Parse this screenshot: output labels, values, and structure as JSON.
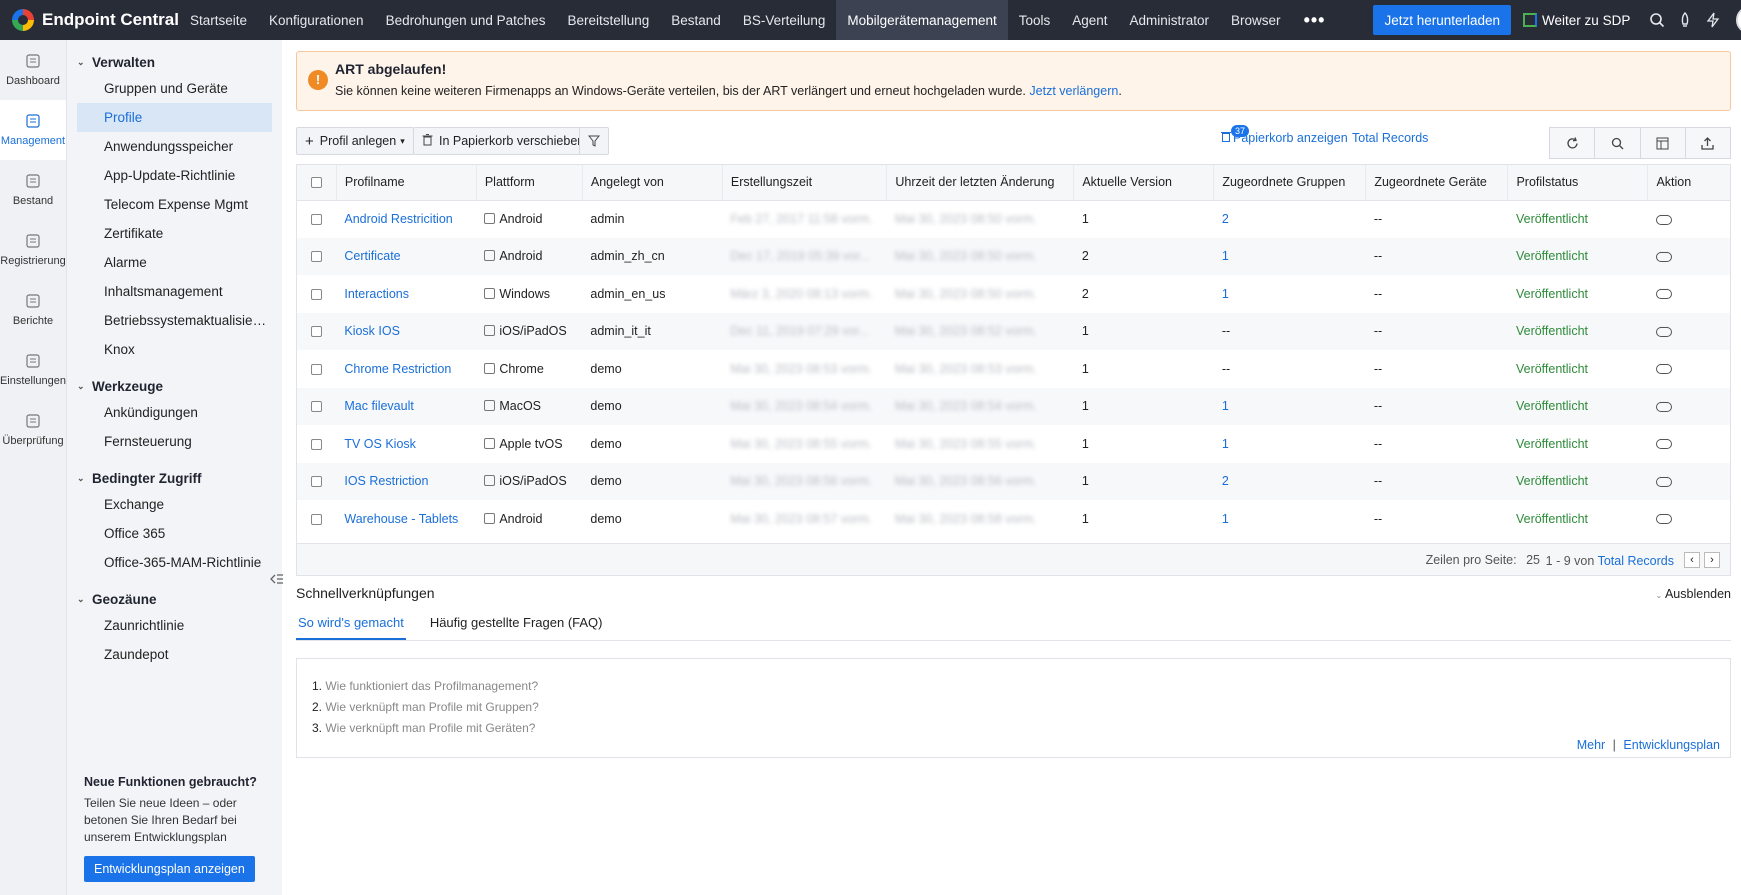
{
  "brand": {
    "name": "Endpoint Central"
  },
  "nav": {
    "items": [
      "Startseite",
      "Konfigurationen",
      "Bedrohungen und Patches",
      "Bereitstellung",
      "Bestand",
      "BS-Verteilung",
      "Mobilgerätemanagement",
      "Tools",
      "Agent",
      "Administrator",
      "Browser"
    ],
    "active_index": 6,
    "more": "•••",
    "download_label": "Jetzt herunterladen",
    "sdp_label": "Weiter zu SDP"
  },
  "rail": [
    {
      "label": "Dashboard",
      "icon": "dashboard-icon"
    },
    {
      "label": "Management",
      "icon": "management-icon",
      "active": true
    },
    {
      "label": "Bestand",
      "icon": "inventory-icon"
    },
    {
      "label": "Registrierung",
      "icon": "enrollment-icon"
    },
    {
      "label": "Berichte",
      "icon": "reports-icon"
    },
    {
      "label": "Einstellungen",
      "icon": "settings-icon"
    },
    {
      "label": "Überprüfung",
      "icon": "audit-icon"
    }
  ],
  "sidebar": {
    "sections": [
      {
        "title": "Verwalten",
        "items": [
          "Gruppen und Geräte",
          "Profile",
          "Anwendungsspeicher",
          "App-Update-Richtlinie",
          "Telecom Expense Mgmt",
          "Zertifikate",
          "Alarme",
          "Inhaltsmanagement",
          "Betriebssystemaktualisierung...",
          "Knox"
        ]
      },
      {
        "title": "Werkzeuge",
        "items": [
          "Ankündigungen",
          "Fernsteuerung"
        ]
      },
      {
        "title": "Bedingter Zugriff",
        "items": [
          "Exchange",
          "Office 365",
          "Office-365-MAM-Richtlinie"
        ]
      },
      {
        "title": "Geozäune",
        "items": [
          "Zaunrichtlinie",
          "Zaundepot"
        ]
      }
    ],
    "promo": {
      "title": "Neue Funktionen gebraucht?",
      "text": "Teilen Sie neue Ideen – oder betonen Sie Ihren Bedarf bei unserem Entwicklungsplan",
      "button": "Entwicklungsplan anzeigen"
    }
  },
  "alert": {
    "title": "ART abgelaufen!",
    "text": "Sie können keine weiteren Firmenapps an Windows-Geräte verteilen, bis der ART verlängert und erneut hochgeladen wurde.",
    "link": "Jetzt verlängern",
    "link_suffix": "."
  },
  "toolbar": {
    "create_label": "Profil anlegen",
    "trash_label": "In Papierkorb verschieben",
    "trash_count": "37",
    "show_trash": "Papierkorb anzeigen",
    "total_records": "Total Records"
  },
  "table": {
    "columns": [
      "Profilname",
      "Plattform",
      "Angelegt von",
      "Erstellungszeit",
      "Uhrzeit der letzten Änderung",
      "Aktuelle Version",
      "Zugeordnete Gruppen",
      "Zugeordnete Geräte",
      "Profilstatus",
      "Aktion"
    ],
    "rows": [
      {
        "name": "Android Restricition",
        "platform": "Android",
        "created_by": "admin",
        "created": "Feb 27, 2017 11:58 vorm.",
        "modified": "Mai 30, 2023 08:50 vorm.",
        "version": "1",
        "groups": "2",
        "devices": "--",
        "status": "Veröffentlicht"
      },
      {
        "name": "Certificate",
        "platform": "Android",
        "created_by": "admin_zh_cn",
        "created": "Dec 17, 2019 05:39 vor...",
        "modified": "Mai 30, 2023 08:50 vorm.",
        "version": "2",
        "groups": "1",
        "devices": "--",
        "status": "Veröffentlicht"
      },
      {
        "name": "Interactions",
        "platform": "Windows",
        "created_by": "admin_en_us",
        "created": "März 3, 2020 08:13 vorm.",
        "modified": "Mai 30, 2023 08:50 vorm.",
        "version": "2",
        "groups": "1",
        "devices": "--",
        "status": "Veröffentlicht"
      },
      {
        "name": "Kiosk IOS",
        "platform": "iOS/iPadOS",
        "created_by": "admin_it_it",
        "created": "Dec 11, 2019 07:29 vor...",
        "modified": "Mai 30, 2023 08:52 vorm.",
        "version": "1",
        "groups": "--",
        "devices": "--",
        "status": "Veröffentlicht"
      },
      {
        "name": "Chrome Restriction",
        "platform": "Chrome",
        "created_by": "demo",
        "created": "Mai 30, 2023 08:53 vorm.",
        "modified": "Mai 30, 2023 08:53 vorm.",
        "version": "1",
        "groups": "--",
        "devices": "--",
        "status": "Veröffentlicht"
      },
      {
        "name": "Mac filevault",
        "platform": "MacOS",
        "created_by": "demo",
        "created": "Mai 30, 2023 08:54 vorm.",
        "modified": "Mai 30, 2023 08:54 vorm.",
        "version": "1",
        "groups": "1",
        "devices": "--",
        "status": "Veröffentlicht"
      },
      {
        "name": "TV OS Kiosk",
        "platform": "Apple tvOS",
        "created_by": "demo",
        "created": "Mai 30, 2023 08:55 vorm.",
        "modified": "Mai 30, 2023 08:55 vorm.",
        "version": "1",
        "groups": "1",
        "devices": "--",
        "status": "Veröffentlicht"
      },
      {
        "name": "IOS Restriction",
        "platform": "iOS/iPadOS",
        "created_by": "demo",
        "created": "Mai 30, 2023 08:56 vorm.",
        "modified": "Mai 30, 2023 08:56 vorm.",
        "version": "1",
        "groups": "2",
        "devices": "--",
        "status": "Veröffentlicht"
      },
      {
        "name": "Warehouse - Tablets",
        "platform": "Android",
        "created_by": "demo",
        "created": "Mai 30, 2023 08:57 vorm.",
        "modified": "Mai 30, 2023 08:58 vorm.",
        "version": "1",
        "groups": "1",
        "devices": "--",
        "status": "Veröffentlicht"
      }
    ],
    "pager": {
      "rows_per_page_label": "Zeilen pro Seite:",
      "rows_per_page": "25",
      "range": "1 - 9 von",
      "total_link": "Total Records",
      "prev": "‹",
      "next": "›"
    }
  },
  "quick": {
    "title": "Schnellverknüpfungen",
    "hide": "Ausblenden",
    "tabs": [
      "So wird's gemacht",
      "Häufig gestellte Fragen (FAQ)"
    ],
    "questions": [
      "Wie funktioniert das Profilmanagement?",
      "Wie verknüpft man Profile mit Gruppen?",
      "Wie verknüpft man Profile mit Geräten?"
    ],
    "more": "Mehr",
    "separator": "|",
    "roadmap": "Entwicklungsplan"
  },
  "colors": {
    "topbar": "#282c37",
    "accent": "#1a73e8",
    "link": "#1a6fd8",
    "status": "#2e8b3a",
    "alert_bg": "#fff4ea"
  }
}
